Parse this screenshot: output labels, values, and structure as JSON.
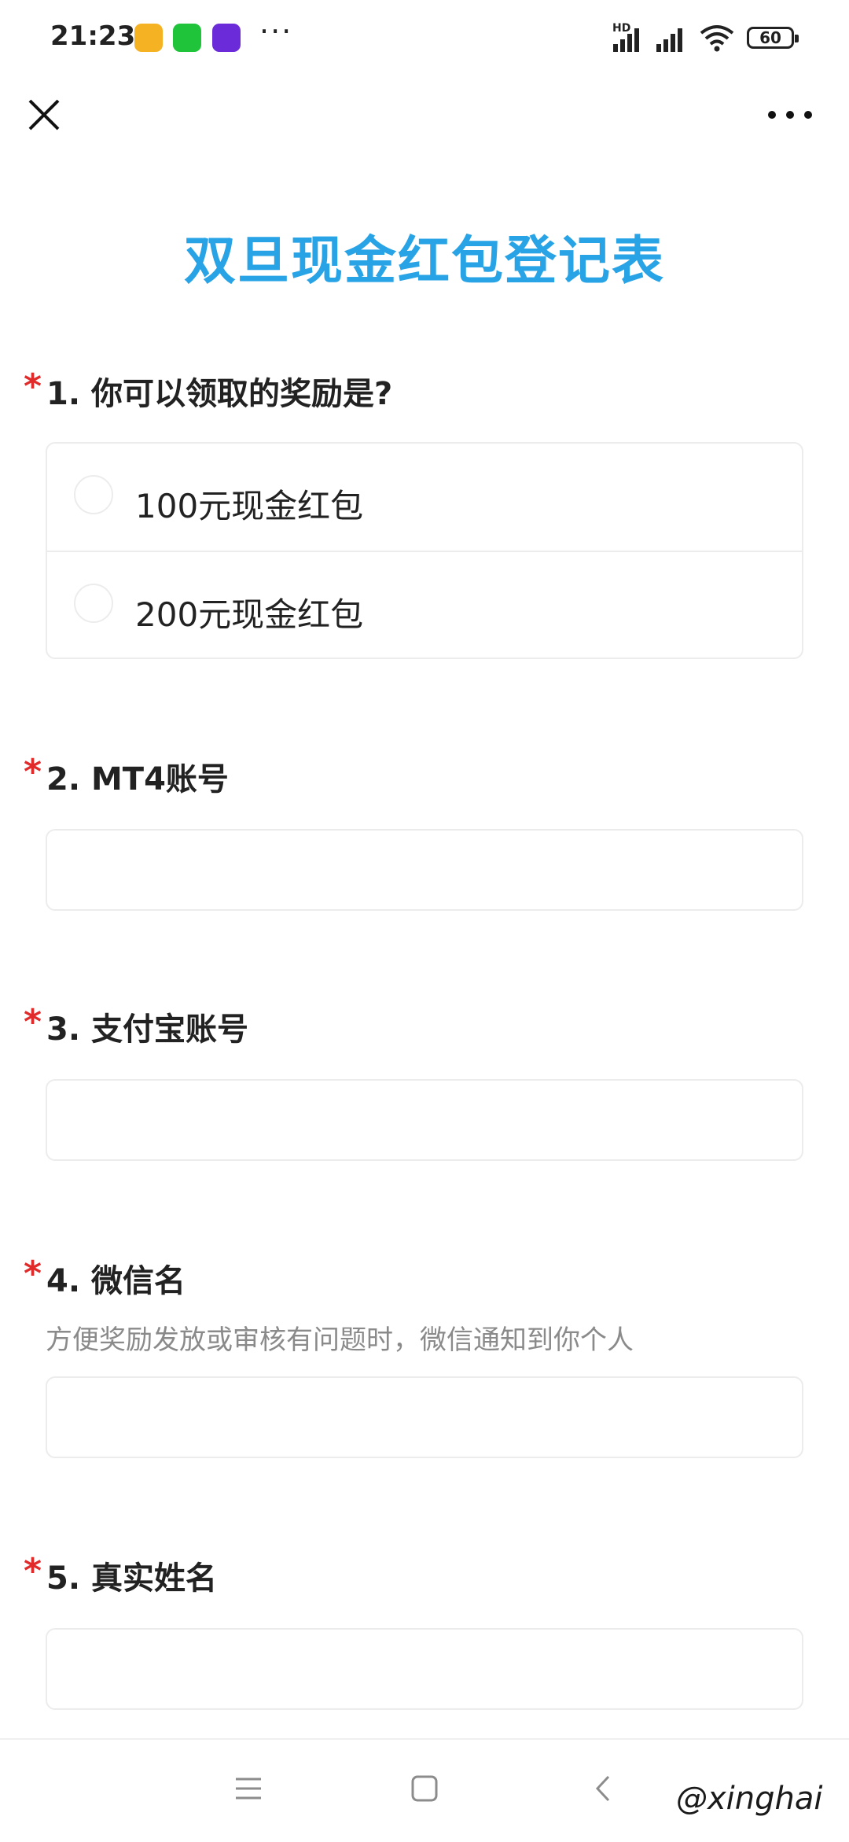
{
  "status_bar": {
    "time": "21:23",
    "hd_label": "HD",
    "battery": "60",
    "overflow": "···",
    "app_icons": [
      {
        "name": "messages-app-icon",
        "color": "#f5b324"
      },
      {
        "name": "iqiyi-app-icon",
        "color": "#1fc43a"
      },
      {
        "name": "video-app-icon",
        "color": "#6b2bd9"
      }
    ]
  },
  "nav": {
    "close_icon": "close-icon",
    "more_icon": "more-icon"
  },
  "form": {
    "title": "双旦现金红包登记表",
    "questions": [
      {
        "number": "1.",
        "label": "你可以领取的奖励是?",
        "required": "*",
        "type": "radio",
        "options": [
          "100元现金红包",
          "200元现金红包"
        ]
      },
      {
        "number": "2.",
        "label": "MT4账号",
        "required": "*",
        "type": "text",
        "value": ""
      },
      {
        "number": "3.",
        "label": "支付宝账号",
        "required": "*",
        "type": "text",
        "value": ""
      },
      {
        "number": "4.",
        "label": "微信名",
        "required": "*",
        "type": "text",
        "value": "",
        "hint": "方便奖励发放或审核有问题时，微信通知到你个人"
      },
      {
        "number": "5.",
        "label": "真实姓名",
        "required": "*",
        "type": "text",
        "value": ""
      }
    ]
  },
  "colors": {
    "title": "#27a3e6",
    "required_star": "#e12b2b",
    "border": "#ececec"
  },
  "watermark": "@xinghai"
}
